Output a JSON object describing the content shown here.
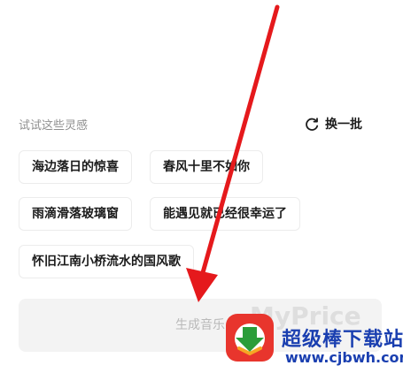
{
  "inspiration": {
    "title": "试试这些灵感",
    "refresh_label": "换一批",
    "chips": [
      "海边落日的惊喜",
      "春风十里不如你",
      "雨滴滑落玻璃窗",
      "能遇见就已经很幸运了",
      "怀旧江南小桥流水的国风歌"
    ]
  },
  "generate_button_label": "生成音乐",
  "watermark": {
    "faded_text": "MyPrice",
    "brand": "超级棒下载站",
    "url": "www.cjbwh.com"
  },
  "colors": {
    "arrow": "#e5191c",
    "title_text": "#8f8f8f",
    "button_bg": "#f3f3f3",
    "button_text": "#b9b9b9",
    "watermark_brand": "#1a3fb0"
  }
}
